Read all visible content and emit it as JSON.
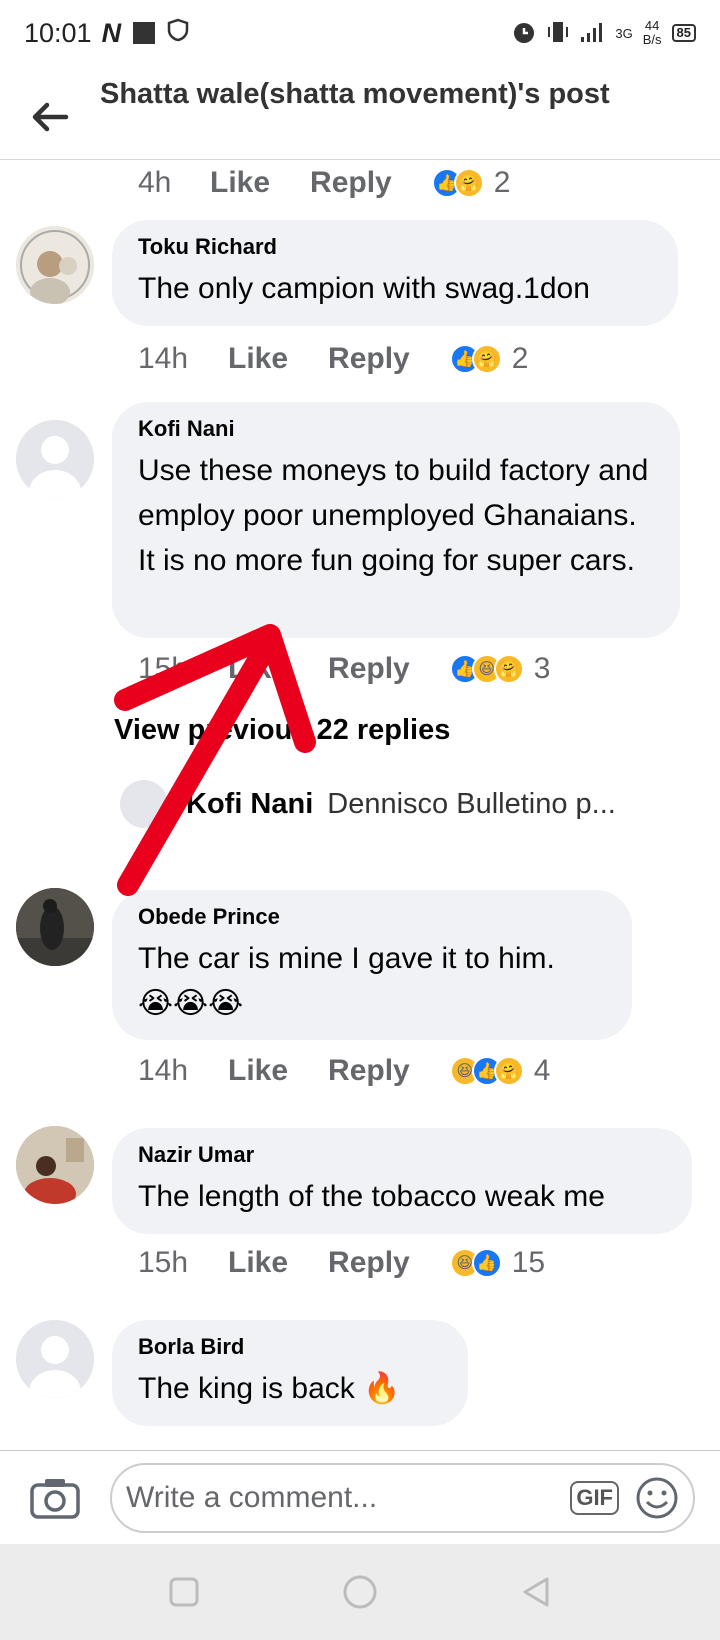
{
  "status_bar": {
    "time": "10:01",
    "net_speed_value": "44",
    "net_speed_unit": "B/s",
    "battery": "85",
    "network": "3G"
  },
  "header": {
    "title": "Shatta wale(shatta movement)'s post"
  },
  "actions": {
    "like": "Like",
    "reply": "Reply"
  },
  "top_meta": {
    "time": "4h",
    "count": "2"
  },
  "comments": [
    {
      "name": "Toku Richard",
      "text": "The only campion with swag.1don",
      "time": "14h",
      "reactions": [
        "like",
        "care"
      ],
      "count": "2"
    },
    {
      "name": "Kofi Nani",
      "text": "Use these moneys to build factory and employ poor unemployed Ghanaians. It is no more fun going for super cars.",
      "time": "15h",
      "reactions": [
        "like",
        "haha",
        "care"
      ],
      "count": "3"
    },
    {
      "name": "Obede Prince",
      "text": "The car is mine I gave it to him.",
      "emoji": "😭😭😭",
      "time": "14h",
      "reactions": [
        "haha",
        "like",
        "care"
      ],
      "count": "4"
    },
    {
      "name": "Nazir Umar",
      "text": "The length of the tobacco weak me",
      "time": "15h",
      "reactions": [
        "haha",
        "like"
      ],
      "count": "15"
    },
    {
      "name": "Borla Bird",
      "text": "The king is back 🔥"
    }
  ],
  "replies": {
    "view_previous": "View previous 22 replies",
    "preview_name": "Kofi Nani",
    "preview_text": "Dennisco Bulletino p..."
  },
  "composer": {
    "placeholder": "Write a comment...",
    "gif_label": "GIF"
  },
  "colors": {
    "like_blue": "#1877f2",
    "bubble": "#f0f2f5",
    "arrow_red": "#e8001c"
  }
}
